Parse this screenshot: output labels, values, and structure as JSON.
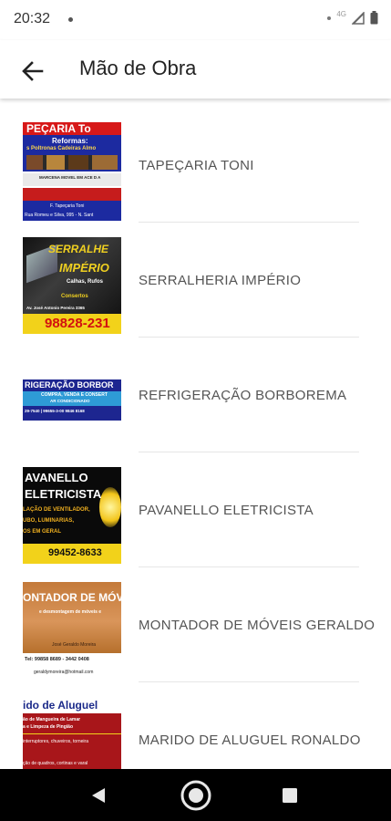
{
  "status": {
    "time": "20:32",
    "network": "4G"
  },
  "header": {
    "title": "Mão de Obra"
  },
  "items": [
    {
      "label": "TAPEÇARIA TONI",
      "thumb": {
        "title": "PEÇARIA To",
        "l1": "Reformas:",
        "l2": "s Poltronas Cadeiras Almo",
        "l3": "MARCENA MOVEL EM ACE D A",
        "l4": "F. Tapeçaria Toni",
        "l5": "Rua Romeu e Silva, 995 - N. Sant"
      }
    },
    {
      "label": "SERRALHERIA IMPÉRIO",
      "thumb": {
        "title": "SERRALHE",
        "sub": "IMPÉRIO",
        "l1": "Calhas, Rufos",
        "l2": "Consertos",
        "l3": "Av. José Antonio Pereira 3365",
        "phone": "98828-231"
      }
    },
    {
      "label": "REFRIGERAÇÃO BORBOREMA",
      "thumb": {
        "title": "RIGERAÇÃO BORBOR",
        "l1": "COMPRA, VENDA E CONSERT",
        "l2": "AR CONDICIONADO",
        "l3": "29-7540 | 99655-3-00 9846 8168"
      }
    },
    {
      "label": "PAVANELLO ELETRICISTA",
      "thumb": {
        "title": "AVANELLO",
        "sub": "ELETRICISTA",
        "l1": "LAÇÃO DE VENTILADOR,",
        "l2": "UBO, LUMINARIAS,",
        "l3": "OS EM GERAL",
        "phone": "99452-8633"
      }
    },
    {
      "label": "MONTADOR DE MÓVEIS GERALDO",
      "thumb": {
        "title": "ONTADOR DE MÓVE",
        "l1": "e desmontagem de móveis e",
        "l2": "José Geraldo Moreira",
        "l3": "Tel: 99858 8689 - 3442 0408",
        "l4": "geraldymoreira@hotmail.com"
      }
    },
    {
      "label": "MARIDO DE ALUGUEL RONALDO",
      "thumb": {
        "title": "ido de Aluguel",
        "l1": "ão de Mangueira de Lamar",
        "l2": "a e Limpeza de Pingião",
        "l3": "interruptores, chuveiros, torneira",
        "l4": "ção de quadros, cortinas e varal"
      }
    }
  ],
  "colors": {
    "accent": "#222222",
    "divider": "#e6e6e6",
    "label": "#555555"
  },
  "icons": {
    "back": "arrow-back-icon",
    "nav_back": "nav-back-icon",
    "nav_home": "nav-home-icon",
    "nav_recents": "nav-recents-icon"
  }
}
